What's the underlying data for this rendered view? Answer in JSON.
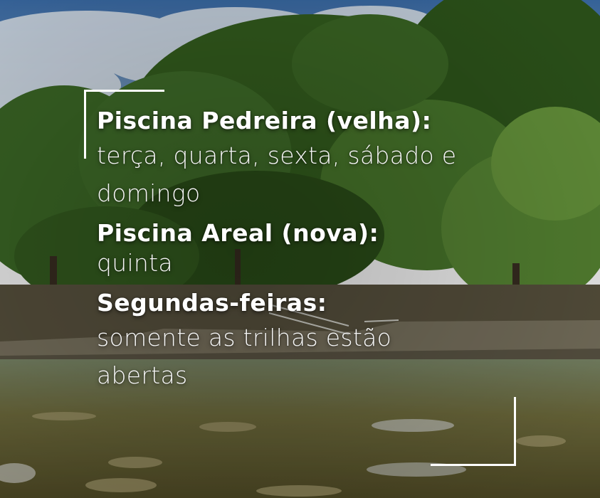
{
  "schedule": [
    {
      "heading": "Piscina Pedreira (velha):",
      "lines": [
        "terça, quarta, sexta, sábado e",
        "domingo"
      ]
    },
    {
      "heading": "Piscina Areal (nova):",
      "lines": [
        "quinta"
      ]
    },
    {
      "heading": "Segundas-feiras:",
      "lines": [
        "somente as trilhas estão",
        "abertas"
      ]
    }
  ],
  "colors": {
    "text": "#ffffff",
    "sky": "#4a78b0",
    "foliage": "#3f6a2a",
    "water": "#6b6a3a"
  }
}
